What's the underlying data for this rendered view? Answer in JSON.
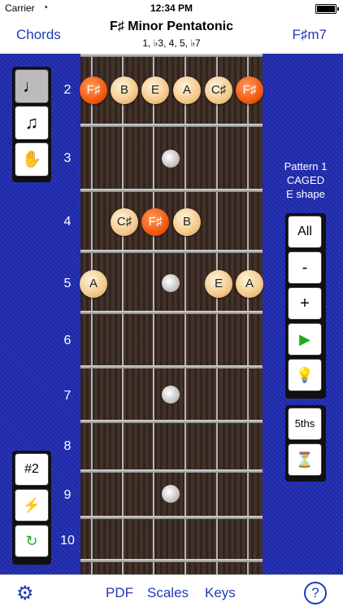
{
  "status": {
    "carrier": "Carrier",
    "time": "12:34 PM"
  },
  "nav": {
    "left": "Chords",
    "title": "F♯ Minor Pentatonic",
    "subtitle": "1, ♭3, 4, 5, ♭7",
    "right": "F♯m7"
  },
  "fret_numbers": [
    "2",
    "3",
    "4",
    "5",
    "6",
    "7",
    "8",
    "9",
    "10"
  ],
  "notes": {
    "r2": [
      "F♯",
      "B",
      "E",
      "A",
      "C♯",
      "F♯"
    ],
    "r4": [
      "C♯",
      "F♯",
      "B"
    ],
    "r5": [
      "A",
      "E",
      "A"
    ]
  },
  "pattern": {
    "line1": "Pattern 1",
    "line2": "CAGED",
    "line3": "E shape"
  },
  "left_tools": {
    "sharp_label": "#2"
  },
  "right_tools": {
    "all": "All",
    "minus": "-",
    "plus": "+",
    "fifths": "5ths"
  },
  "tabbar": {
    "pdf": "PDF",
    "scales": "Scales",
    "keys": "Keys"
  },
  "colors": {
    "accent": "#1f3bb8",
    "background": "#1f2ab0",
    "root": "#f25a10",
    "note": "#f3c98a"
  }
}
